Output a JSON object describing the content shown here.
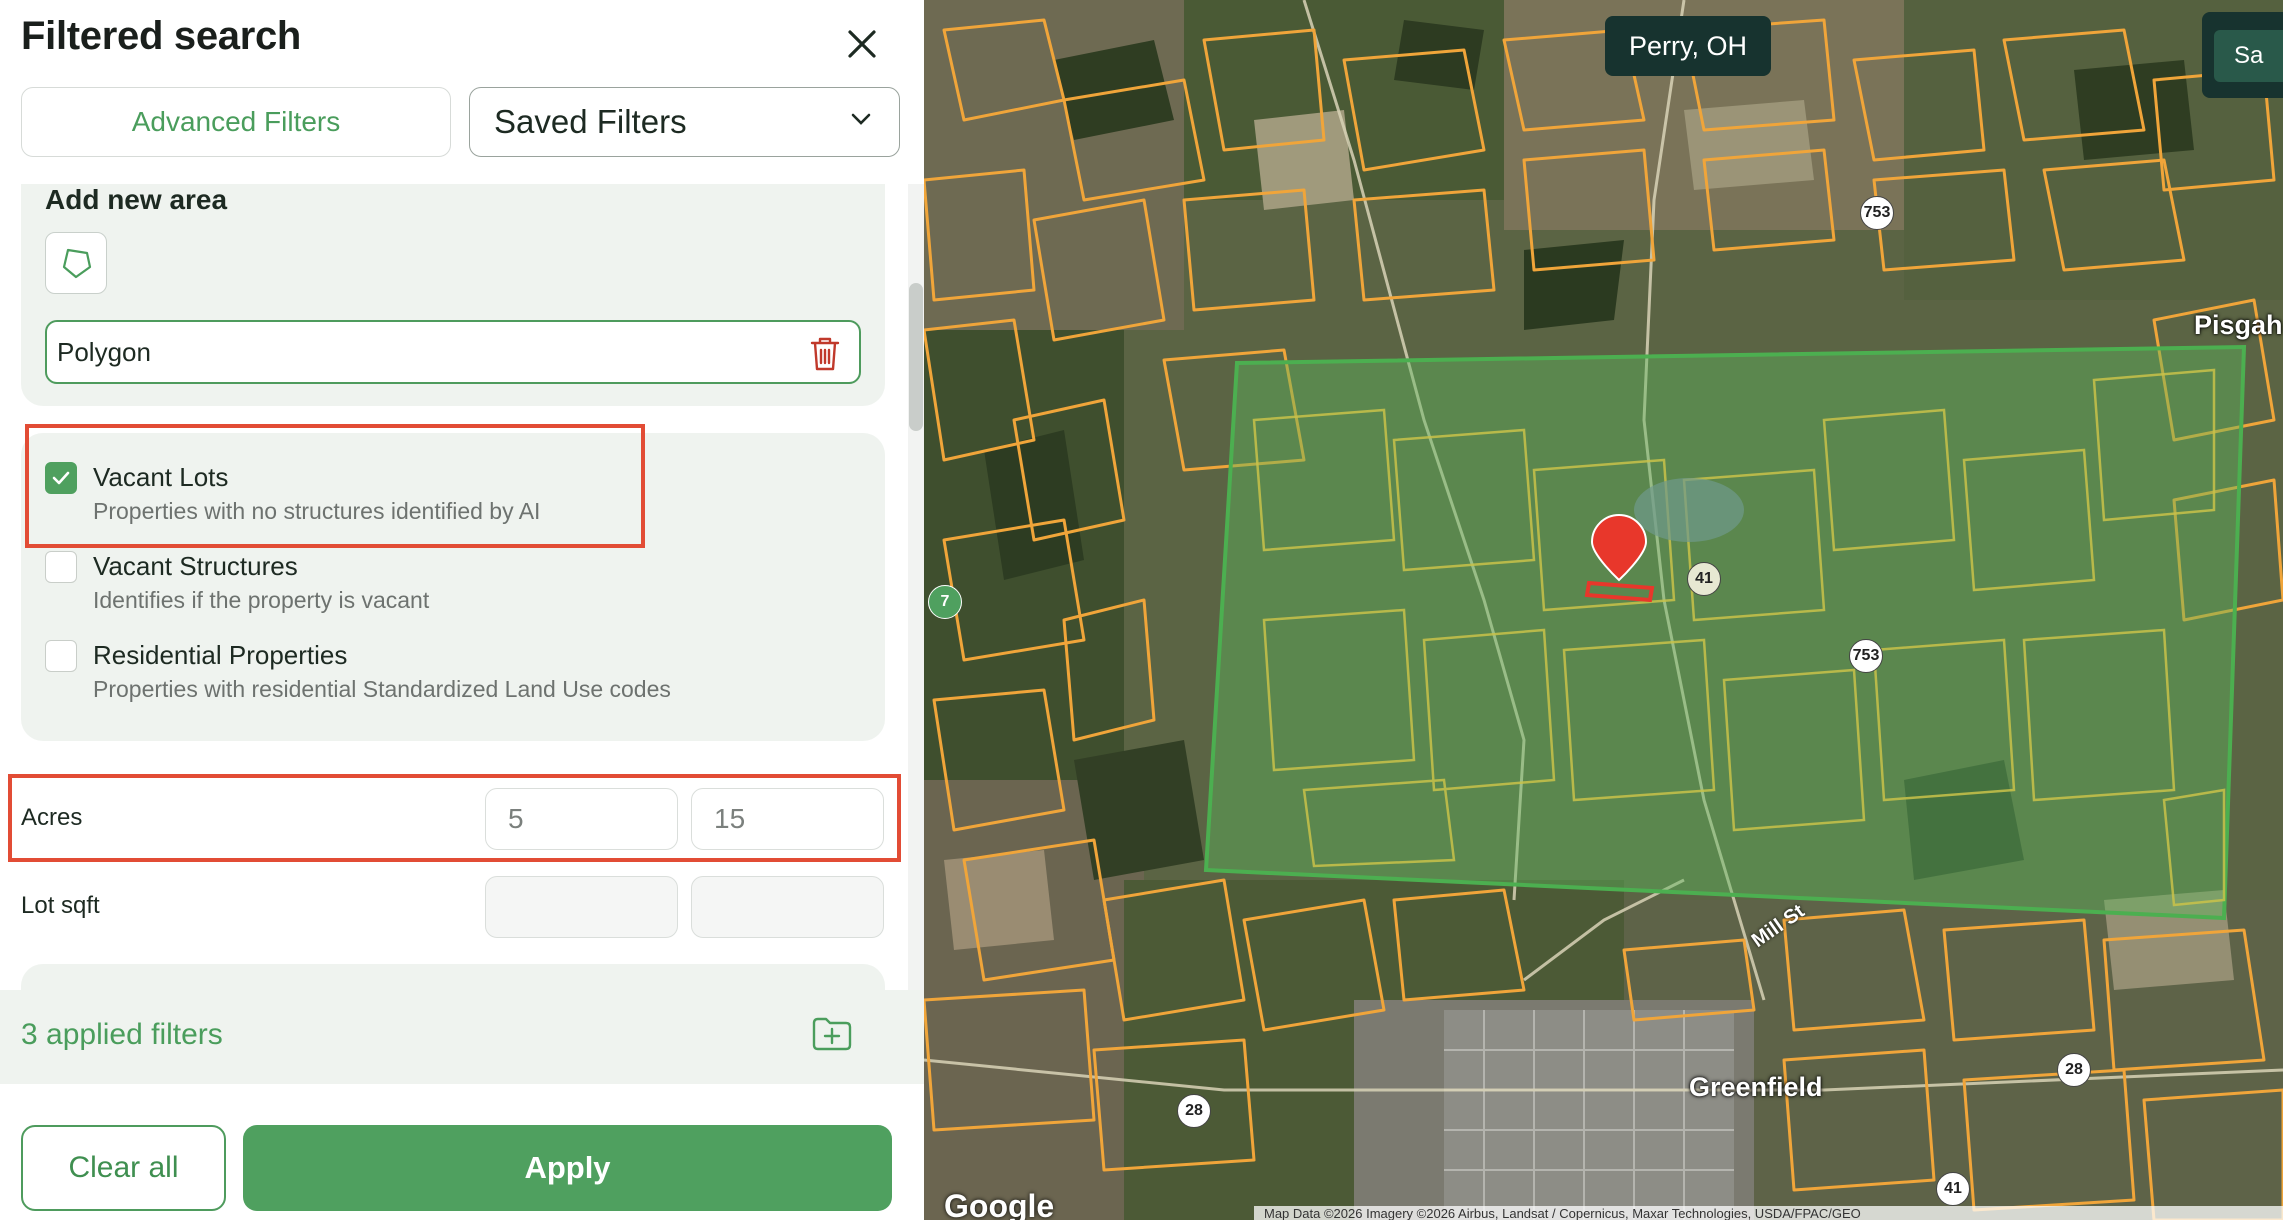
{
  "panel": {
    "title": "Filtered search",
    "tabs": {
      "advanced": "Advanced Filters",
      "saved": "Saved Filters"
    },
    "area": {
      "heading": "Add new area",
      "field_value": "Polygon"
    },
    "options": [
      {
        "label": "Vacant Lots",
        "sub": "Properties with no structures identified by AI",
        "checked": true
      },
      {
        "label": "Vacant Structures",
        "sub": "Identifies if the property is vacant",
        "checked": false
      },
      {
        "label": "Residential Properties",
        "sub": "Properties with residential Standardized Land Use codes",
        "checked": false
      }
    ],
    "acres": {
      "label": "Acres",
      "min": "5",
      "max": "15"
    },
    "lot_sqft": {
      "label": "Lot sqft",
      "min": "",
      "max": ""
    },
    "applied": "3 applied filters",
    "buttons": {
      "clear": "Clear all",
      "apply": "Apply"
    }
  },
  "map": {
    "location_chip": "Perry, OH",
    "save_button": "Sa",
    "places": {
      "pisgah": "Pisgah",
      "greenfield": "Greenfield",
      "street": "Mill St"
    },
    "routes": [
      "753",
      "41",
      "753",
      "28",
      "28",
      "41"
    ],
    "google_logo": "Google",
    "attribution": "Map Data ©2026 Imagery ©2026 Airbus, Landsat / Copernicus, Maxar Technologies, USDA/FPAC/GEO",
    "colors": {
      "parcel": "#f0a53a",
      "selection": "#4caf50",
      "marker": "#e8372b"
    }
  }
}
